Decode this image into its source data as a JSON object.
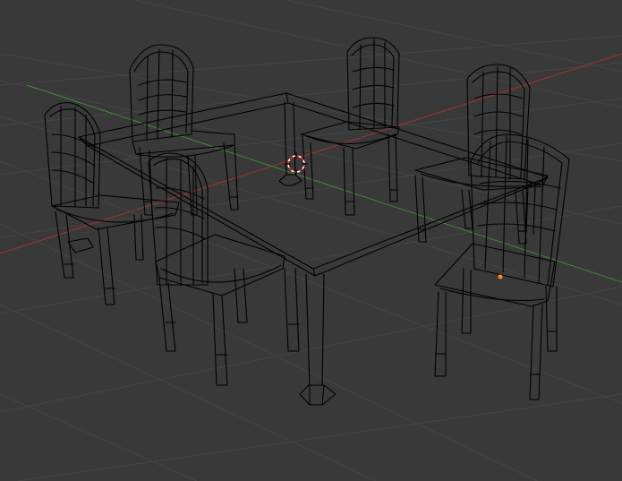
{
  "app": {
    "name": "3D viewport",
    "shading_mode": "wireframe"
  },
  "scene": {
    "objects": [
      {
        "name": "table",
        "type": "mesh"
      },
      {
        "name": "chair",
        "type": "mesh",
        "count": 6
      }
    ]
  },
  "colors": {
    "background": "#393939",
    "grid": "#444444",
    "x_axis": "#a03232",
    "y_axis": "#3c8c32",
    "wire": "#000000",
    "cursor_red": "#ff2020",
    "cursor_white": "#ffffff",
    "selection_origin": "#ff8c1a"
  },
  "icons": {
    "cursor": "3d-cursor-icon",
    "origin": "object-origin-icon"
  }
}
